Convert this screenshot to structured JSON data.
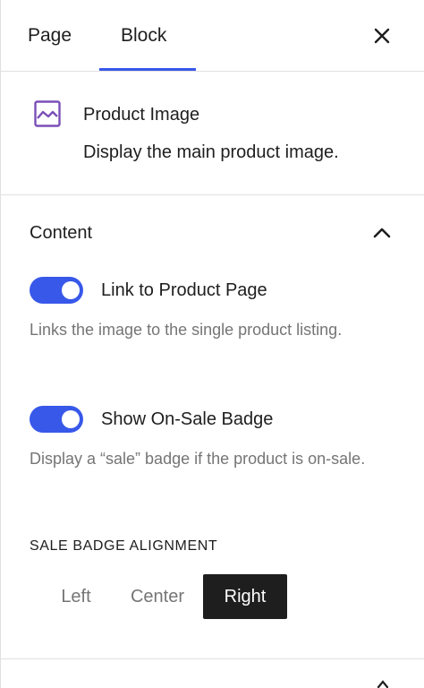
{
  "tabs": {
    "page": "Page",
    "block": "Block",
    "active": "Block"
  },
  "header": {
    "close_icon": "close-icon"
  },
  "block_card": {
    "icon": "image-icon",
    "icon_color": "#7a4fb8",
    "title": "Product Image",
    "description": "Display the main product image."
  },
  "content_panel": {
    "title": "Content",
    "chevron_icon": "chevron-up-icon",
    "toggles": [
      {
        "label": "Link to Product Page",
        "help": "Links the image to the single product listing.",
        "checked": true
      },
      {
        "label": "Show On-Sale Badge",
        "help": "Display a “sale” badge if the product is on-sale.",
        "checked": true
      }
    ],
    "alignment": {
      "label": "SALE BADGE ALIGNMENT",
      "options": [
        "Left",
        "Center",
        "Right"
      ],
      "selected": "Right"
    }
  },
  "colors": {
    "accent": "#3858e9",
    "text": "#1e1e1e",
    "muted": "#757575",
    "border": "#e0e0e0"
  }
}
